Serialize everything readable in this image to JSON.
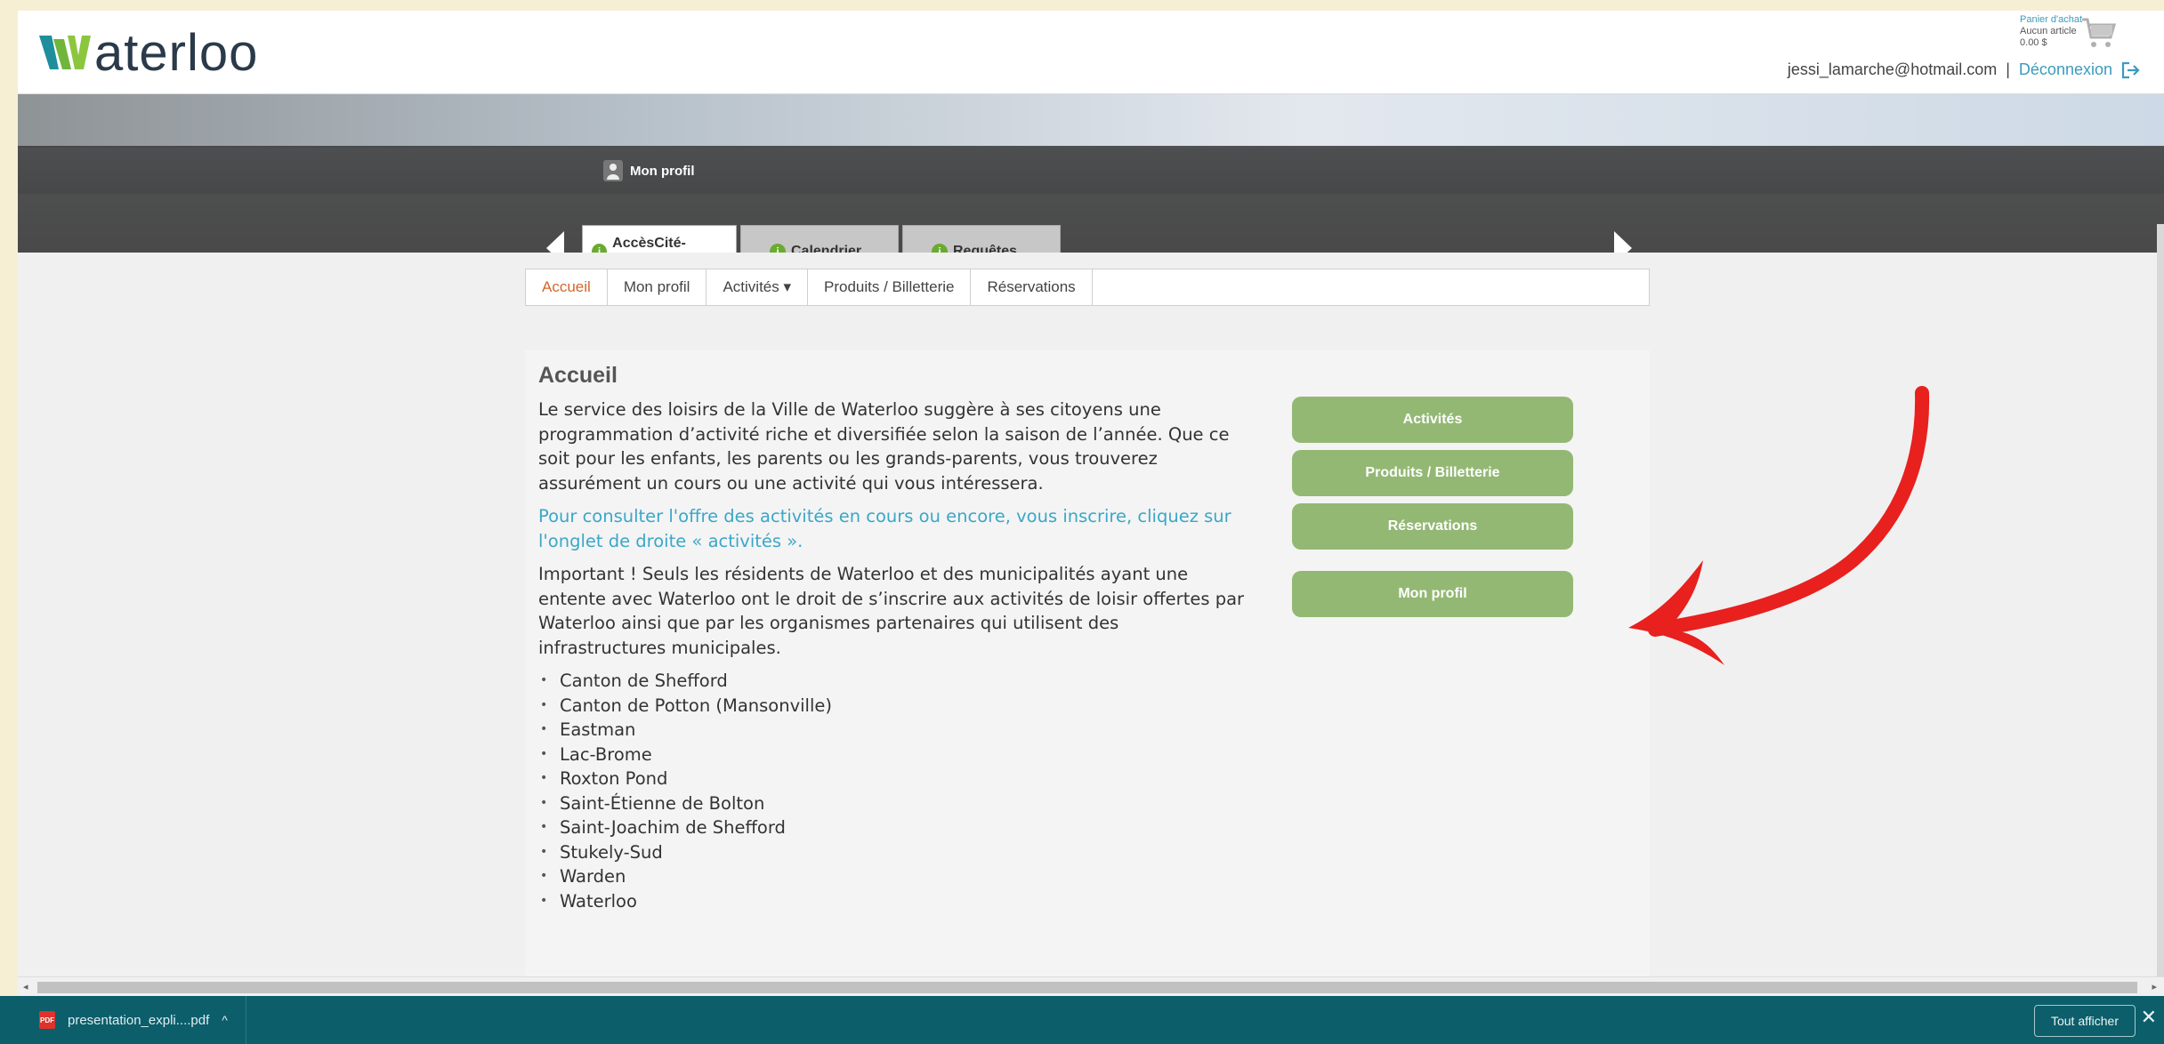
{
  "header": {
    "logo_text": "aterloo",
    "cart": {
      "title": "Panier d'achat",
      "items": "Aucun article",
      "total": "0.00 $"
    },
    "user_email": "jessi_lamarche@hotmail.com",
    "separator": "|",
    "logout_label": "Déconnexion"
  },
  "banner": {
    "profile_link": "Mon profil",
    "tabs": [
      {
        "label": "AccèsCité-Loisirs",
        "active": true
      },
      {
        "label": "Calendrier",
        "active": false
      },
      {
        "label": "Requêtes",
        "active": false
      }
    ]
  },
  "subnav": {
    "items": [
      {
        "label": "Accueil",
        "active": true
      },
      {
        "label": "Mon profil"
      },
      {
        "label": "Activités ▾"
      },
      {
        "label": "Produits / Billetterie"
      },
      {
        "label": "Réservations"
      }
    ]
  },
  "main": {
    "title": "Accueil",
    "intro": "Le service des loisirs de la Ville de Waterloo suggère à ses citoyens une programmation d’activité riche et diversifiée selon la saison de l’année. Que ce soit pour les enfants, les parents ou les grands-parents, vous trouverez assurément un cours ou une activité qui vous intéressera.",
    "link_text": "Pour consulter l'offre des activités en cours ou encore, vous inscrire, cliquez sur l'onglet de droite « activités ».",
    "important": "Important ! Seuls les résidents de Waterloo et des municipalités ayant une entente avec Waterloo ont le droit de s’inscrire aux activités de loisir offertes par Waterloo ainsi que par les organismes partenaires qui utilisent des infrastructures municipales.",
    "municipalities": [
      "Canton de Shefford",
      "Canton de Potton (Mansonville)",
      "Eastman",
      "Lac-Brome",
      "Roxton Pond",
      "Saint-Étienne de Bolton",
      "Saint-Joachim de Shefford",
      "Stukely-Sud",
      "Warden",
      "Waterloo"
    ],
    "buttons": {
      "activites": "Activités",
      "produits": "Produits / Billetterie",
      "reservations": "Réservations",
      "mon_profil": "Mon profil"
    }
  },
  "download_bar": {
    "file_name": "presentation_expli....pdf",
    "pdf_badge": "PDF",
    "show_all": "Tout afficher"
  },
  "colors": {
    "accent_green": "#93b874",
    "link_blue": "#3ba7c7",
    "active_orange": "#d4672a",
    "annotation_red": "#e8201e",
    "download_bar": "#0c5e6b"
  }
}
